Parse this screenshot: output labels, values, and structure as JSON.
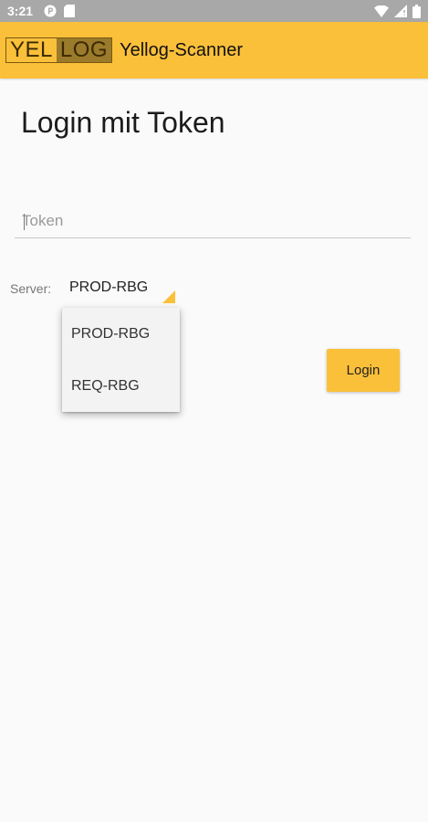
{
  "status_bar": {
    "time": "3:21"
  },
  "app_bar": {
    "logo_left": "YEL",
    "logo_right": "LOG",
    "title": "Yellog-Scanner"
  },
  "login": {
    "title": "Login mit Token",
    "token_placeholder": "Token",
    "token_value": "",
    "server_label": "Server:",
    "server_selected": "PROD-RBG",
    "server_options": [
      "PROD-RBG",
      "REQ-RBG"
    ],
    "login_button": "Login"
  },
  "colors": {
    "accent": "#fbc03a",
    "logo_dark": "#9b7a2c",
    "status_bar": "#a8a8a8",
    "background": "#fafafa"
  },
  "icons": {
    "status_left": [
      "parking-icon",
      "sd-card-icon"
    ],
    "status_right": [
      "wifi-icon",
      "signal-icon",
      "battery-icon"
    ],
    "spinner": "dropdown-arrow-icon"
  }
}
